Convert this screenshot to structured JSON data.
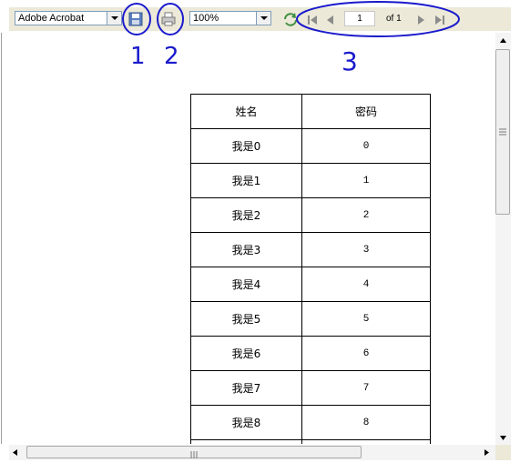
{
  "toolbar": {
    "reader_select": "Adobe Acrobat",
    "zoom_select": "100%",
    "page_current": "1",
    "page_total": "of 1"
  },
  "table": {
    "headers": [
      "姓名",
      "密码"
    ],
    "rows": [
      [
        "我是0",
        "0"
      ],
      [
        "我是1",
        "1"
      ],
      [
        "我是2",
        "2"
      ],
      [
        "我是3",
        "3"
      ],
      [
        "我是4",
        "4"
      ],
      [
        "我是5",
        "5"
      ],
      [
        "我是6",
        "6"
      ],
      [
        "我是7",
        "7"
      ],
      [
        "我是8",
        "8"
      ],
      [
        "",
        ""
      ]
    ]
  },
  "annotations": {
    "labels": [
      "1",
      "2",
      "3"
    ],
    "color": "#1a1acc"
  },
  "colors": {
    "toolbar_bg": "#ece9d8",
    "save_icon": "#5b7fbf",
    "nav_icon": "#8c8c8c"
  }
}
